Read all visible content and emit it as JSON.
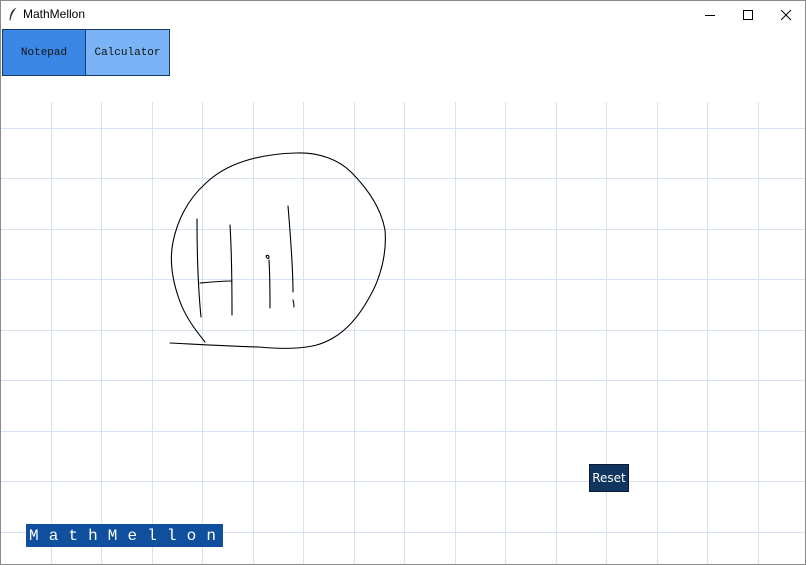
{
  "window": {
    "title": "MathMellon",
    "icon": "feather-icon",
    "controls": [
      "minimize-icon",
      "maximize-icon",
      "close-icon"
    ]
  },
  "tabs": {
    "notepad_label": "Notepad",
    "calculator_label": "Calculator",
    "active": "Notepad"
  },
  "canvas": {
    "background": "graph-paper grid",
    "grid_color": "#d7e2f1",
    "strokes_color": "#000000",
    "drawing": "freehand circle enclosing handwritten 'Hi'"
  },
  "reset_label": "Reset",
  "brand_label": "MathMellon",
  "colors": {
    "notepad_tab": "#3b87e6",
    "calculator_tab": "#7ab4f6",
    "reset_button": "#10355f",
    "brand_label_bg": "#0f4f9e"
  }
}
